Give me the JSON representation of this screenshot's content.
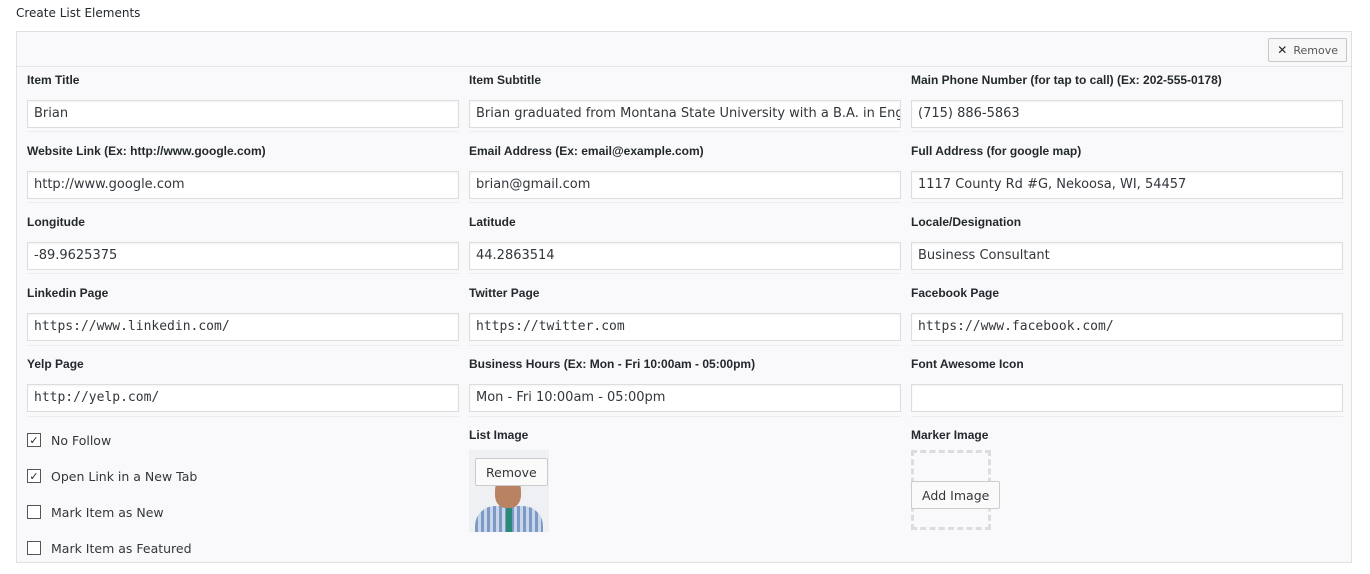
{
  "section_title": "Create List Elements",
  "remove_label": "Remove",
  "fields": {
    "item_title": {
      "label": "Item Title",
      "value": "Brian"
    },
    "item_subtitle": {
      "label": "Item Subtitle",
      "value": "Brian graduated from Montana State University with a B.A. in English"
    },
    "main_phone": {
      "label": "Main Phone Number (for tap to call) (Ex: 202-555-0178)",
      "value": "(715) 886-5863"
    },
    "website": {
      "label": "Website Link (Ex: http://www.google.com)",
      "value": "http://www.google.com"
    },
    "email": {
      "label": "Email Address (Ex: email@example.com)",
      "value": "brian@gmail.com"
    },
    "full_address": {
      "label": "Full Address (for google map)",
      "value": "1117 County Rd #G, Nekoosa, WI, 54457"
    },
    "longitude": {
      "label": "Longitude",
      "value": "-89.9625375"
    },
    "latitude": {
      "label": "Latitude",
      "value": "44.2863514"
    },
    "locale": {
      "label": "Locale/Designation",
      "value": "Business Consultant"
    },
    "linkedin": {
      "label": "Linkedin Page",
      "value": "https://www.linkedin.com/"
    },
    "twitter": {
      "label": "Twitter Page",
      "value": "https://twitter.com"
    },
    "facebook": {
      "label": "Facebook Page",
      "value": "https://www.facebook.com/"
    },
    "yelp": {
      "label": "Yelp Page",
      "value": "http://yelp.com/"
    },
    "business_hours": {
      "label": "Business Hours (Ex: Mon - Fri 10:00am - 05:00pm)",
      "value": "Mon - Fri 10:00am - 05:00pm"
    },
    "font_awesome": {
      "label": "Font Awesome Icon",
      "value": ""
    }
  },
  "checkboxes": {
    "no_follow": {
      "label": "No Follow",
      "checked": true
    },
    "new_tab": {
      "label": "Open Link in a New Tab",
      "checked": true
    },
    "mark_new": {
      "label": "Mark Item as New",
      "checked": false
    },
    "mark_featured": {
      "label": "Mark Item as Featured",
      "checked": false
    }
  },
  "list_image": {
    "label": "List Image",
    "remove_label": "Remove"
  },
  "marker_image": {
    "label": "Marker Image",
    "add_label": "Add Image"
  }
}
